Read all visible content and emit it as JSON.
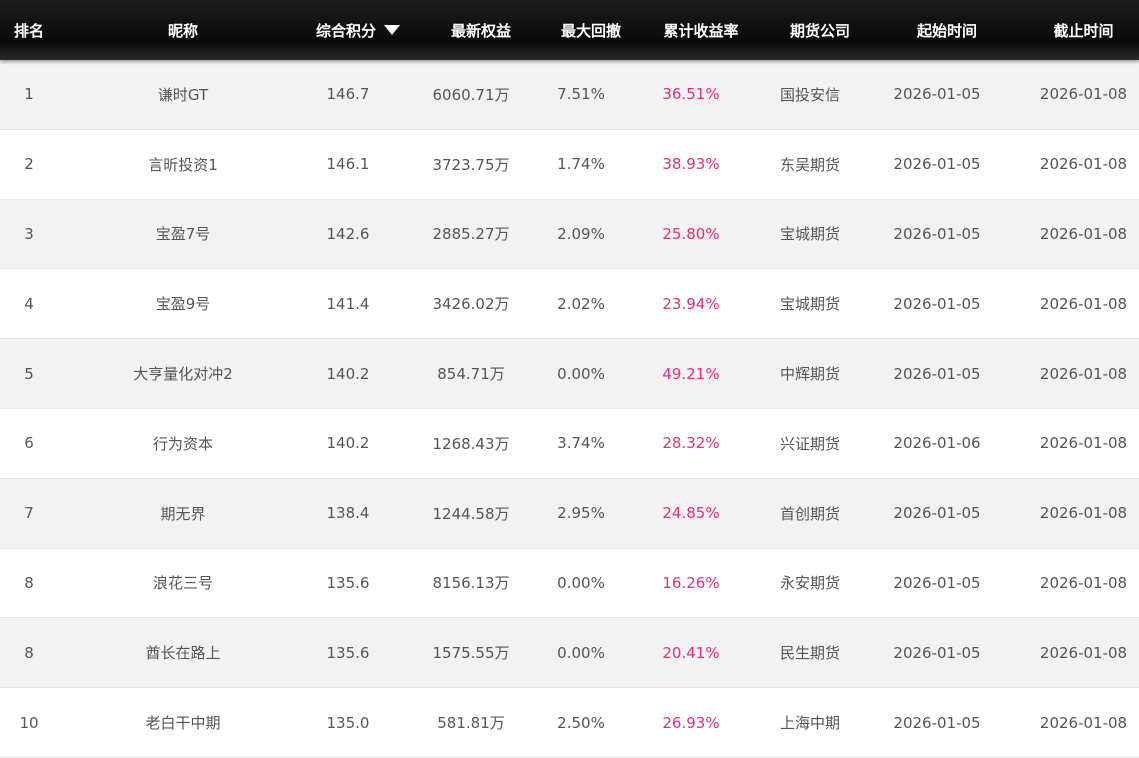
{
  "colors": {
    "header_bg": "#111111",
    "header_text": "#ffffff",
    "row_odd": "#f2f2f2",
    "row_even": "#ffffff",
    "text": "#555555",
    "rate": "#e0307a"
  },
  "header": {
    "rank": "排名",
    "nickname": "昵称",
    "score": "综合积分",
    "score_sort_icon": "caret-down-icon",
    "equity": "最新权益",
    "drawdown": "最大回撤",
    "return_rate": "累计收益率",
    "broker": "期货公司",
    "start": "起始时间",
    "end": "截止时间"
  },
  "rows": [
    {
      "rank": "1",
      "nickname": "谦时GT",
      "score": "146.7",
      "equity": "6060.71万",
      "drawdown": "7.51%",
      "return_rate": "36.51%",
      "broker": "国投安信",
      "start": "2026-01-05",
      "end": "2026-01-08"
    },
    {
      "rank": "2",
      "nickname": "言昕投资1",
      "score": "146.1",
      "equity": "3723.75万",
      "drawdown": "1.74%",
      "return_rate": "38.93%",
      "broker": "东吴期货",
      "start": "2026-01-05",
      "end": "2026-01-08"
    },
    {
      "rank": "3",
      "nickname": "宝盈7号",
      "score": "142.6",
      "equity": "2885.27万",
      "drawdown": "2.09%",
      "return_rate": "25.80%",
      "broker": "宝城期货",
      "start": "2026-01-05",
      "end": "2026-01-08"
    },
    {
      "rank": "4",
      "nickname": "宝盈9号",
      "score": "141.4",
      "equity": "3426.02万",
      "drawdown": "2.02%",
      "return_rate": "23.94%",
      "broker": "宝城期货",
      "start": "2026-01-05",
      "end": "2026-01-08"
    },
    {
      "rank": "5",
      "nickname": "大亨量化对冲2",
      "score": "140.2",
      "equity": "854.71万",
      "drawdown": "0.00%",
      "return_rate": "49.21%",
      "broker": "中辉期货",
      "start": "2026-01-05",
      "end": "2026-01-08"
    },
    {
      "rank": "6",
      "nickname": "行为资本",
      "score": "140.2",
      "equity": "1268.43万",
      "drawdown": "3.74%",
      "return_rate": "28.32%",
      "broker": "兴证期货",
      "start": "2026-01-06",
      "end": "2026-01-08"
    },
    {
      "rank": "7",
      "nickname": "期无界",
      "score": "138.4",
      "equity": "1244.58万",
      "drawdown": "2.95%",
      "return_rate": "24.85%",
      "broker": "首创期货",
      "start": "2026-01-05",
      "end": "2026-01-08"
    },
    {
      "rank": "8",
      "nickname": "浪花三号",
      "score": "135.6",
      "equity": "8156.13万",
      "drawdown": "0.00%",
      "return_rate": "16.26%",
      "broker": "永安期货",
      "start": "2026-01-05",
      "end": "2026-01-08"
    },
    {
      "rank": "8",
      "nickname": "酋长在路上",
      "score": "135.6",
      "equity": "1575.55万",
      "drawdown": "0.00%",
      "return_rate": "20.41%",
      "broker": "民生期货",
      "start": "2026-01-05",
      "end": "2026-01-08"
    },
    {
      "rank": "10",
      "nickname": "老白干中期",
      "score": "135.0",
      "equity": "581.81万",
      "drawdown": "2.50%",
      "return_rate": "26.93%",
      "broker": "上海中期",
      "start": "2026-01-05",
      "end": "2026-01-08"
    }
  ]
}
